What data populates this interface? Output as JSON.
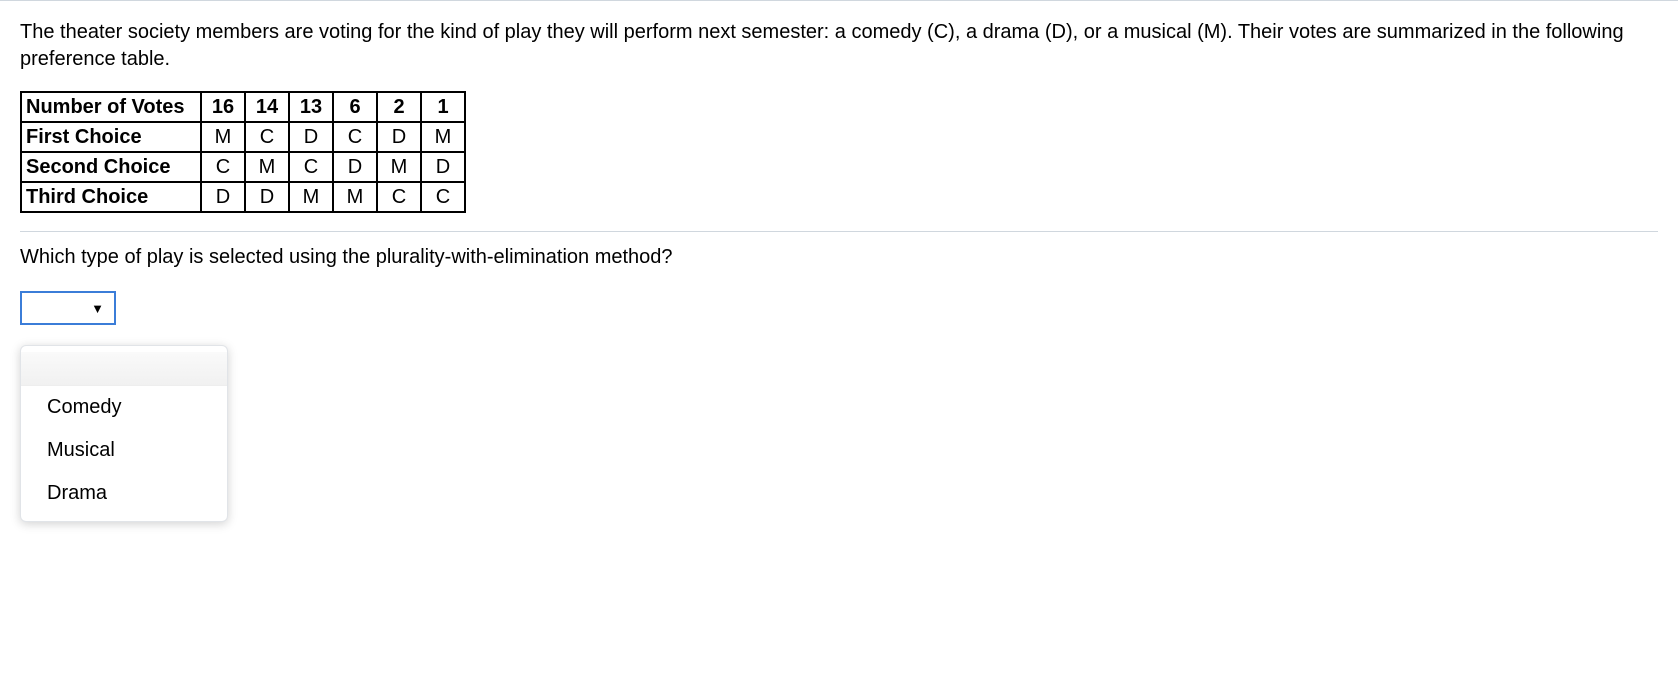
{
  "problem": {
    "text": "The theater society members are voting for the kind of play they will perform next semester: a comedy (C), a drama (D), or a musical (M). Their votes are summarized in the following preference table."
  },
  "table": {
    "headers": [
      "Number of Votes",
      "16",
      "14",
      "13",
      "6",
      "2",
      "1"
    ],
    "rows": [
      {
        "label": "First Choice",
        "cells": [
          "M",
          "C",
          "D",
          "C",
          "D",
          "M"
        ]
      },
      {
        "label": "Second Choice",
        "cells": [
          "C",
          "M",
          "C",
          "D",
          "M",
          "D"
        ]
      },
      {
        "label": "Third Choice",
        "cells": [
          "D",
          "D",
          "M",
          "M",
          "C",
          "C"
        ]
      }
    ]
  },
  "question": "Which type of play is selected using the plurality-with-elimination method?",
  "select": {
    "value": "",
    "options": [
      "",
      "Comedy",
      "Musical",
      "Drama"
    ]
  }
}
